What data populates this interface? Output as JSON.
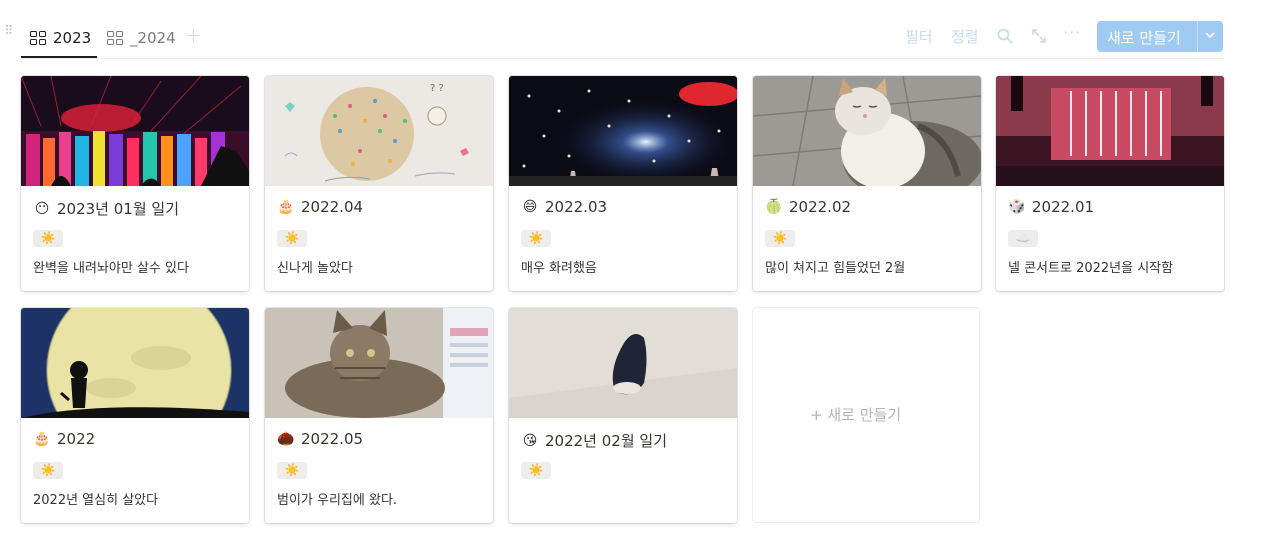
{
  "tabs": [
    {
      "label": "2023",
      "active": true
    },
    {
      "label": "_2024",
      "active": false
    }
  ],
  "toolbar": {
    "filter": "필터",
    "sort": "정렬",
    "more": "···",
    "new_button": "새로 만들기",
    "accent": "#9fcaf1"
  },
  "cards": [
    {
      "emoji": "😶",
      "title": "2023년 01월 일기",
      "weather": "☀️",
      "desc": "완벽을 내려놔야만 살수 있다"
    },
    {
      "emoji": "🎂",
      "title": "2022.04",
      "weather": "☀️",
      "desc": "신나게 놀았다"
    },
    {
      "emoji": "😄",
      "title": "2022.03",
      "weather": "☀️",
      "desc": "매우 화려했음"
    },
    {
      "emoji": "🍈",
      "title": "2022.02",
      "weather": "☀️",
      "desc": "많이 쳐지고 힘들었던 2월"
    },
    {
      "emoji": "🎲",
      "title": "2022.01",
      "weather": "☁️",
      "desc": "넬 콘서트로 2022년을 시작함"
    },
    {
      "emoji": "🎂",
      "title": "2022",
      "weather": "☀️",
      "desc": "2022년 열심히 살았다"
    },
    {
      "emoji": "🌰",
      "title": "2022.05",
      "weather": "☀️",
      "desc": "범이가 우리집에 왔다."
    },
    {
      "emoji": "😘",
      "title": "2022년 02월 일기",
      "weather": "☀️",
      "desc": ""
    }
  ],
  "new_card": {
    "label": "+ 새로 만들기"
  }
}
